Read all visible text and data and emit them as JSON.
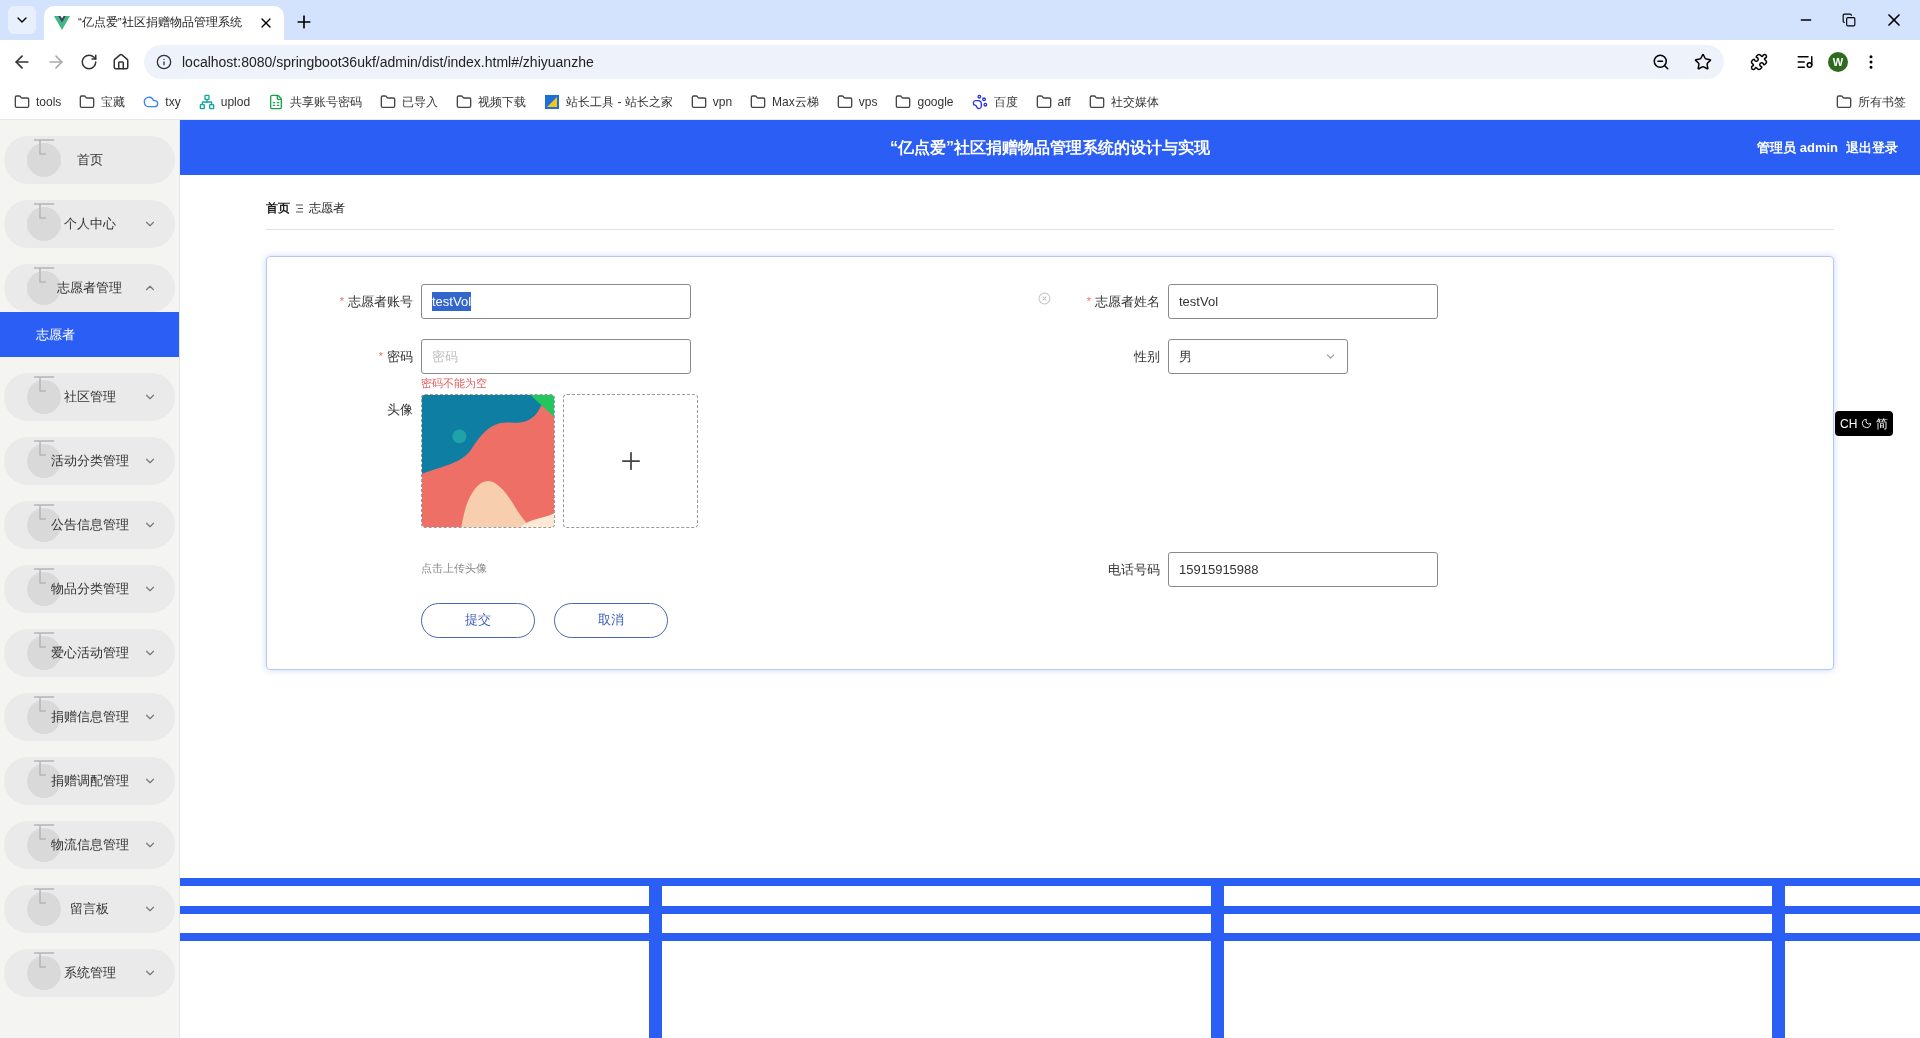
{
  "browser": {
    "tab_title": "“亿点爱”社区捐赠物品管理系统",
    "url": "localhost:8080/springboot36ukf/admin/dist/index.html#/zhiyuanzhe",
    "bookmarks": [
      {
        "label": "tools",
        "kind": "folder"
      },
      {
        "label": "宝藏",
        "kind": "folder"
      },
      {
        "label": "txy",
        "kind": "cloud"
      },
      {
        "label": "uplod",
        "kind": "network"
      },
      {
        "label": "共享账号密码",
        "kind": "sheet"
      },
      {
        "label": "已导入",
        "kind": "folder"
      },
      {
        "label": "视频下载",
        "kind": "folder"
      },
      {
        "label": "站长工具 - 站长之家",
        "kind": "site"
      },
      {
        "label": "vpn",
        "kind": "folder"
      },
      {
        "label": "Max云梯",
        "kind": "folder"
      },
      {
        "label": "vps",
        "kind": "folder"
      },
      {
        "label": "google",
        "kind": "folder"
      },
      {
        "label": "百度",
        "kind": "paw"
      },
      {
        "label": "aff",
        "kind": "folder"
      },
      {
        "label": "社交媒体",
        "kind": "folder"
      }
    ],
    "all_bookmarks": "所有书签",
    "profile_initial": "W"
  },
  "header": {
    "title": "“亿点爱”社区捐赠物品管理系统的设计与实现",
    "user": "管理员 admin",
    "logout": "退出登录"
  },
  "sidebar": {
    "items": [
      {
        "label": "首页"
      },
      {
        "label": "个人中心",
        "expanded": false
      },
      {
        "label": "志愿者管理",
        "expanded": true,
        "children": [
          {
            "label": "志愿者",
            "selected": true
          }
        ]
      },
      {
        "label": "社区管理",
        "expanded": false
      },
      {
        "label": "活动分类管理",
        "expanded": false
      },
      {
        "label": "公告信息管理",
        "expanded": false
      },
      {
        "label": "物品分类管理",
        "expanded": false
      },
      {
        "label": "爱心活动管理",
        "expanded": false
      },
      {
        "label": "捐赠信息管理",
        "expanded": false
      },
      {
        "label": "捐赠调配管理",
        "expanded": false
      },
      {
        "label": "物流信息管理",
        "expanded": false
      },
      {
        "label": "留言板",
        "expanded": false
      },
      {
        "label": "系统管理",
        "expanded": false
      }
    ]
  },
  "breadcrumb": [
    "首页",
    "志愿者"
  ],
  "form": {
    "account": {
      "label": "志愿者账号",
      "required_mark": "*",
      "value": "testVol",
      "text_selected": true
    },
    "password": {
      "label": "密码",
      "required_mark": "*",
      "placeholder": "密码",
      "error": "密码不能为空"
    },
    "avatar": {
      "label": "头像",
      "hint": "点击上传头像"
    },
    "name": {
      "label": "志愿者姓名",
      "required_mark": "*",
      "value": "testVol"
    },
    "gender": {
      "label": "性别",
      "value": "男"
    },
    "phone": {
      "label": "电话号码",
      "value": "15915915988"
    },
    "buttons": [
      "提交",
      "取消"
    ]
  },
  "ime": {
    "lang": "CH",
    "mode": "简"
  }
}
